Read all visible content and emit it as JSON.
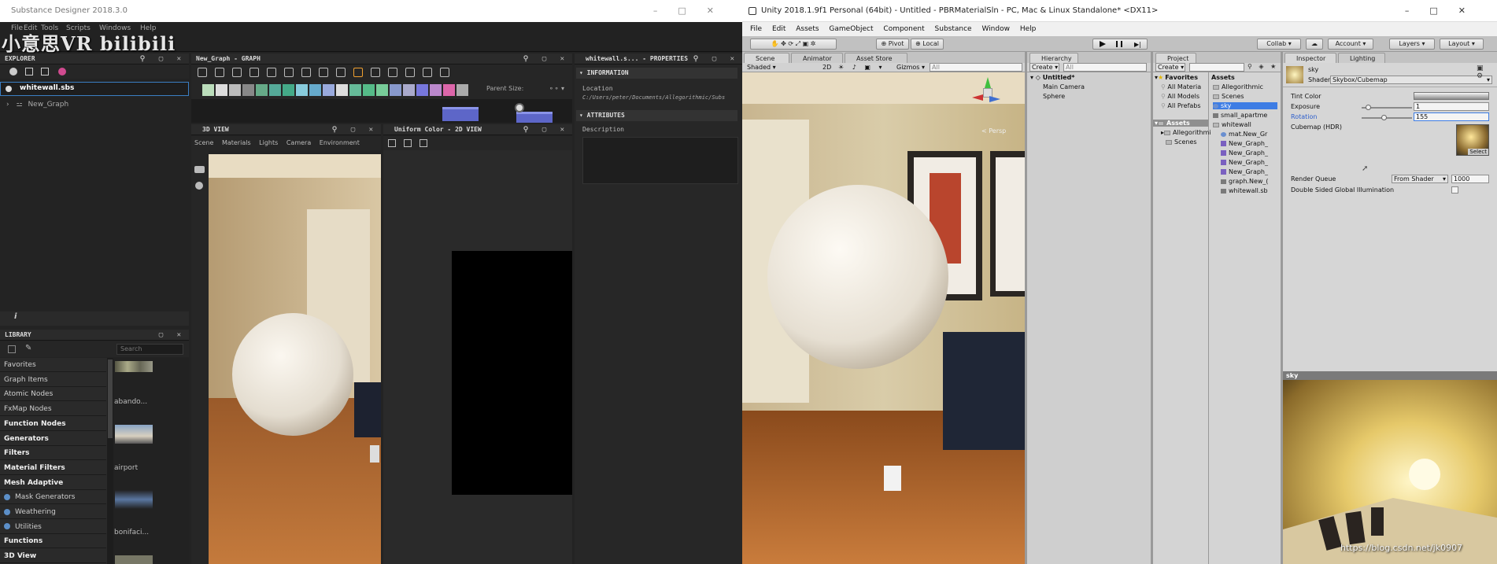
{
  "sd": {
    "title": "Substance Designer 2018.3.0",
    "menus": [
      "File",
      "Edit",
      "Tools",
      "Scripts",
      "Windows",
      "Help"
    ],
    "watermark": "小意思VR bilibili",
    "explorer": {
      "header": "EXPLORER",
      "package": "whitewall.sbs",
      "graph": "New_Graph"
    },
    "graph_panel": {
      "header": "New_Graph - GRAPH",
      "parent_size": "Parent Size:"
    },
    "view3d": {
      "header": "3D VIEW",
      "menus": [
        "Scene",
        "Materials",
        "Lights",
        "Camera",
        "Environment"
      ]
    },
    "view2d": {
      "header": "Uniform Color - 2D VIEW"
    },
    "properties": {
      "header": "whitewall.s... - PROPERTIES",
      "information": "INFORMATION",
      "location_label": "Location",
      "location_value": "C:/Users/peter/Documents/Allegorithmic/Subs",
      "attributes": "ATTRIBUTES",
      "description_label": "Description"
    },
    "library": {
      "header": "LIBRARY",
      "search_placeholder": "Search",
      "items": [
        {
          "label": "Favorites",
          "bold": false
        },
        {
          "label": "Graph Items",
          "bold": false
        },
        {
          "label": "Atomic Nodes",
          "bold": false
        },
        {
          "label": "FxMap Nodes",
          "bold": false
        },
        {
          "label": "Function Nodes",
          "bold": true
        },
        {
          "label": "Generators",
          "bold": true
        },
        {
          "label": "Filters",
          "bold": true
        },
        {
          "label": "Material Filters",
          "bold": true
        },
        {
          "label": "Mesh Adaptive",
          "bold": true
        },
        {
          "label": "Mask Generators",
          "bold": false,
          "icon": true
        },
        {
          "label": "Weathering",
          "bold": false,
          "icon": true
        },
        {
          "label": "Utilities",
          "bold": false,
          "icon": true
        },
        {
          "label": "Functions",
          "bold": true
        },
        {
          "label": "3D View",
          "bold": true
        }
      ],
      "thumbs": [
        "abando...",
        "airport",
        "bonifaci..."
      ]
    }
  },
  "unity": {
    "title": "Unity 2018.1.9f1 Personal (64bit) - Untitled - PBRMaterialSln - PC, Mac & Linux Standalone* <DX11>",
    "menus": [
      "File",
      "Edit",
      "Assets",
      "GameObject",
      "Component",
      "Substance",
      "Window",
      "Help"
    ],
    "toolbar": {
      "pivot": "Pivot",
      "local": "Local",
      "collab": "Collab",
      "account": "Account",
      "layers": "Layers",
      "layout": "Layout"
    },
    "scene": {
      "tabs": [
        "Scene",
        "Animator",
        "Asset Store"
      ],
      "shading": "Shaded",
      "mode_2d": "2D",
      "gizmos": "Gizmos",
      "search_placeholder": "All",
      "persp": "Persp"
    },
    "hierarchy": {
      "tab": "Hierarchy",
      "create": "Create",
      "search_placeholder": "All",
      "scene": "Untitled*",
      "items": [
        "Main Camera",
        "Sphere"
      ]
    },
    "project": {
      "tab": "Project",
      "create": "Create",
      "favorites": "Favorites",
      "fav_items": [
        "All Materia",
        "All Models",
        "All Prefabs"
      ],
      "assets_root": "Assets",
      "tree": [
        "Allegorithmi",
        "Scenes"
      ],
      "assets_header": "Assets",
      "assets": [
        {
          "label": "Allegorithmic",
          "kind": "folder"
        },
        {
          "label": "Scenes",
          "kind": "folder"
        },
        {
          "label": "sky",
          "kind": "material",
          "selected": true
        },
        {
          "label": "small_apartme",
          "kind": "file"
        },
        {
          "label": "whitewall",
          "kind": "folder"
        },
        {
          "label": "mat.New_Gr",
          "kind": "material",
          "sub": true
        },
        {
          "label": "New_Graph_",
          "kind": "graph",
          "sub": true
        },
        {
          "label": "New_Graph_",
          "kind": "graph",
          "sub": true
        },
        {
          "label": "New_Graph_",
          "kind": "graph",
          "sub": true
        },
        {
          "label": "New_Graph_",
          "kind": "graph",
          "sub": true
        },
        {
          "label": "graph.New_(",
          "kind": "file",
          "sub": true
        },
        {
          "label": "whitewall.sb",
          "kind": "file",
          "sub": true
        }
      ]
    },
    "inspector": {
      "tabs": [
        "Inspector",
        "Lighting"
      ],
      "material_name": "sky",
      "shader_label": "Shader",
      "shader_value": "Skybox/Cubemap",
      "tint_label": "Tint Color",
      "exposure_label": "Exposure",
      "exposure_value": "1",
      "exposure_fraction": 0.125,
      "rotation_label": "Rotation",
      "rotation_value": "155",
      "rotation_fraction": 0.43,
      "cubemap_label": "Cubemap   (HDR)",
      "select": "Select",
      "render_queue_label": "Render Queue",
      "render_queue_mode": "From Shader",
      "render_queue_value": "1000",
      "dsgi_label": "Double Sided Global Illumination",
      "preview_title": "sky"
    },
    "url_watermark": "https://blog.csdn.net/jk0907"
  }
}
